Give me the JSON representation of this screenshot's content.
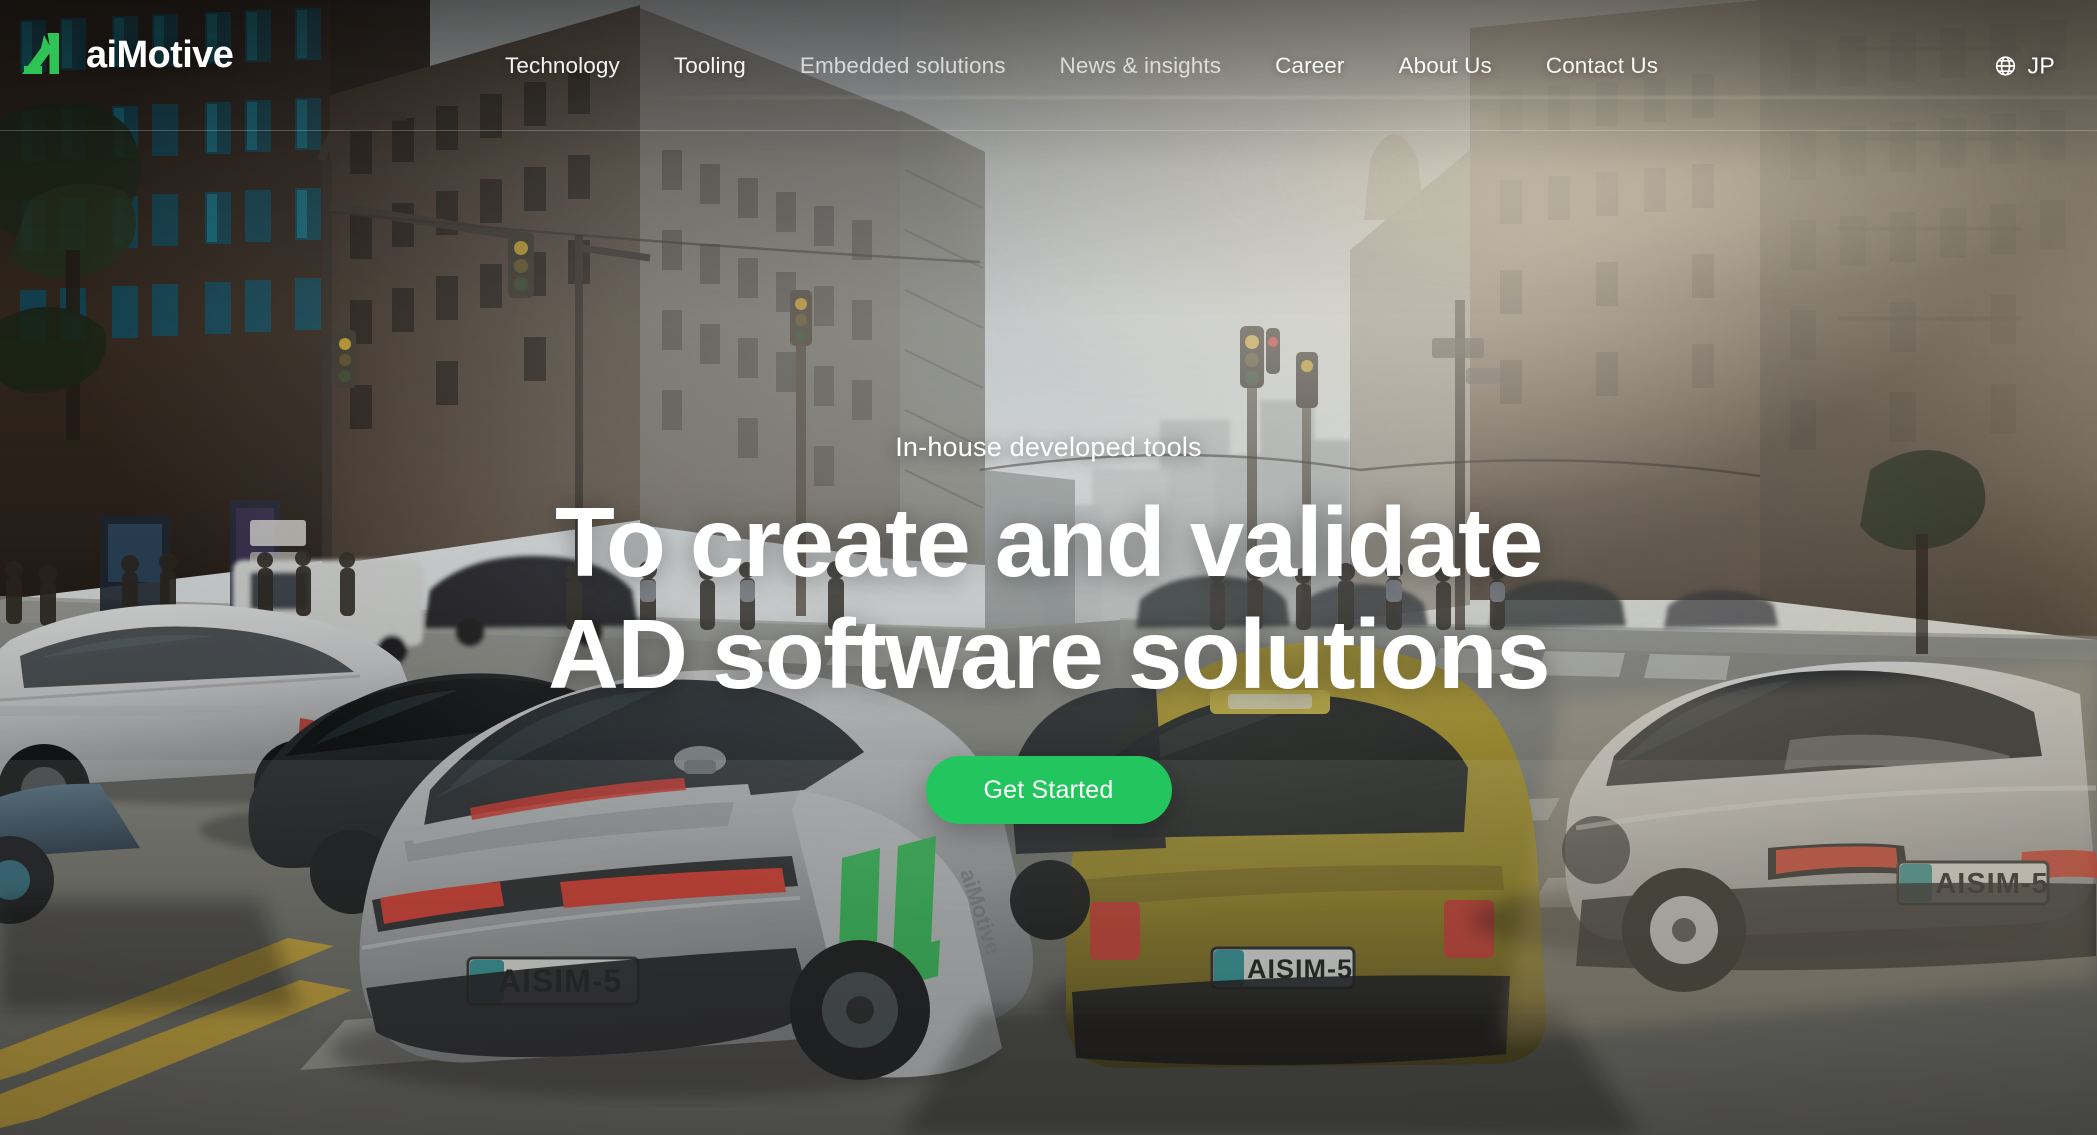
{
  "brand": {
    "name": "aiMotive",
    "logo_icon": "aimotive-logo-mark",
    "accent_color": "#22c55e"
  },
  "nav": {
    "items": [
      {
        "label": "Technology",
        "state": "normal"
      },
      {
        "label": "Tooling",
        "state": "normal"
      },
      {
        "label": "Embedded solutions",
        "state": "dim"
      },
      {
        "label": "News & insights",
        "state": "dim"
      },
      {
        "label": "Career",
        "state": "normal"
      },
      {
        "label": "About Us",
        "state": "normal"
      },
      {
        "label": "Contact Us",
        "state": "normal"
      }
    ],
    "language": {
      "icon": "globe-icon",
      "label": "JP"
    }
  },
  "hero": {
    "eyebrow": "In-house developed tools",
    "title_line1": "To create and validate",
    "title_line2": "AD software solutions",
    "cta_label": "Get Started",
    "cta_color": "#22c55e"
  },
  "scene": {
    "description": "Simulated city street at sunset with autonomous test vehicles",
    "license_plate": "AISIM-5",
    "vehicle_decal": "aiMotive"
  }
}
